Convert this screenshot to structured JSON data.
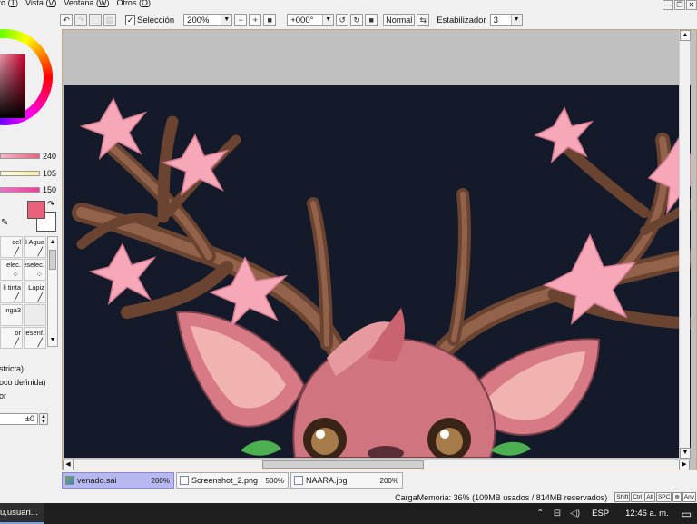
{
  "menu": {
    "items": [
      {
        "label": "ro",
        "key": "T"
      },
      {
        "label": "Vista",
        "key": "V"
      },
      {
        "label": "Ventana",
        "key": "W"
      },
      {
        "label": "Otros",
        "key": "O"
      }
    ]
  },
  "window_controls": {
    "minimize": "—",
    "restore": "❐",
    "close": "✕"
  },
  "toolbar": {
    "selection_label": "Selección",
    "selection_checked": "✓",
    "zoom_value": "200%",
    "rotation_value": "+000°",
    "blend_mode": "Normal",
    "stabilizer_label": "Estabilizador",
    "stabilizer_value": "3"
  },
  "color_panel": {
    "slider_values": [
      "240",
      "105",
      "150"
    ],
    "primary_color": "#e8607a",
    "secondary_color": "#ffffff"
  },
  "tools": [
    {
      "label": "cel",
      "icon": "brush-icon"
    },
    {
      "label": "Al Agua",
      "icon": "water-brush-icon"
    },
    {
      "label": "elec.",
      "icon": "select-icon"
    },
    {
      "label": "Deselec.",
      "icon": "deselect-icon"
    },
    {
      "label": "li tinta",
      "icon": "ink-pen-icon"
    },
    {
      "label": "Lapiz",
      "icon": "pencil-icon"
    },
    {
      "label": "nga3",
      "icon": "sponge-icon"
    },
    {
      "label": "",
      "icon": ""
    },
    {
      "label": "or",
      "icon": "eraser-icon"
    },
    {
      "label": "Desenf.",
      "icon": "blur-icon"
    }
  ],
  "tool_props": {
    "line1": "stricta)",
    "line2": "oco definida)",
    "line3": "or",
    "input_value": "±0"
  },
  "documents": [
    {
      "name": "venado.sai",
      "zoom": "200%",
      "active": true
    },
    {
      "name": "Screenshot_2.png",
      "zoom": "500%",
      "active": false
    },
    {
      "name": "NAARA.jpg",
      "zoom": "200%",
      "active": false
    }
  ],
  "status": {
    "memory_text": "CargaMemoria: 36% (109MB usados / 814MB reservados)",
    "keys": [
      "Shift",
      "Ctrl",
      "Alt",
      "SPC",
      "⊕",
      "Any"
    ]
  },
  "taskbar": {
    "active_item": "u,usuari...",
    "language": "ESP",
    "time": "12:46 a. m."
  }
}
